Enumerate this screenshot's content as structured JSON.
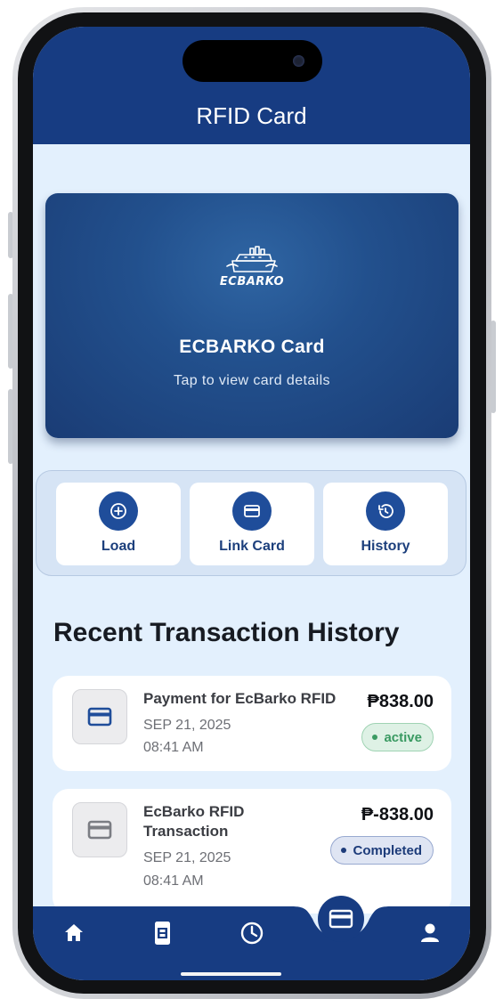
{
  "header": {
    "title": "RFID Card"
  },
  "card": {
    "logo_text": "ECBARKO",
    "title": "ECBARKO Card",
    "subtitle": "Tap to view card details"
  },
  "actions": [
    {
      "label": "Load",
      "icon": "plus-circle-icon"
    },
    {
      "label": "Link Card",
      "icon": "credit-card-icon"
    },
    {
      "label": "History",
      "icon": "history-icon"
    }
  ],
  "transactions_section": {
    "title": "Recent Transaction History",
    "items": [
      {
        "title": "Payment for EcBarko RFID",
        "date": "SEP 21, 2025",
        "time": "08:41 AM",
        "amount": "₱838.00",
        "status": "active",
        "icon": "credit-card-icon",
        "icon_color": "#1f4d9a"
      },
      {
        "title_line1": "EcBarko RFID",
        "title_line2": "Transaction",
        "date": "SEP 21, 2025",
        "time": "08:41 AM",
        "amount": "₱-838.00",
        "status": "Completed",
        "icon": "credit-card-icon",
        "icon_color": "#7b7d83"
      }
    ]
  },
  "bottom_nav": [
    {
      "icon": "home-icon"
    },
    {
      "icon": "ticket-icon"
    },
    {
      "icon": "clock-icon"
    },
    {
      "icon": "credit-card-icon",
      "selected": true
    },
    {
      "icon": "person-icon"
    }
  ],
  "colors": {
    "primary": "#173c82",
    "background": "#e3f0fd",
    "active_green": "#3a9a62",
    "completed_blue": "#1d3c7a"
  }
}
